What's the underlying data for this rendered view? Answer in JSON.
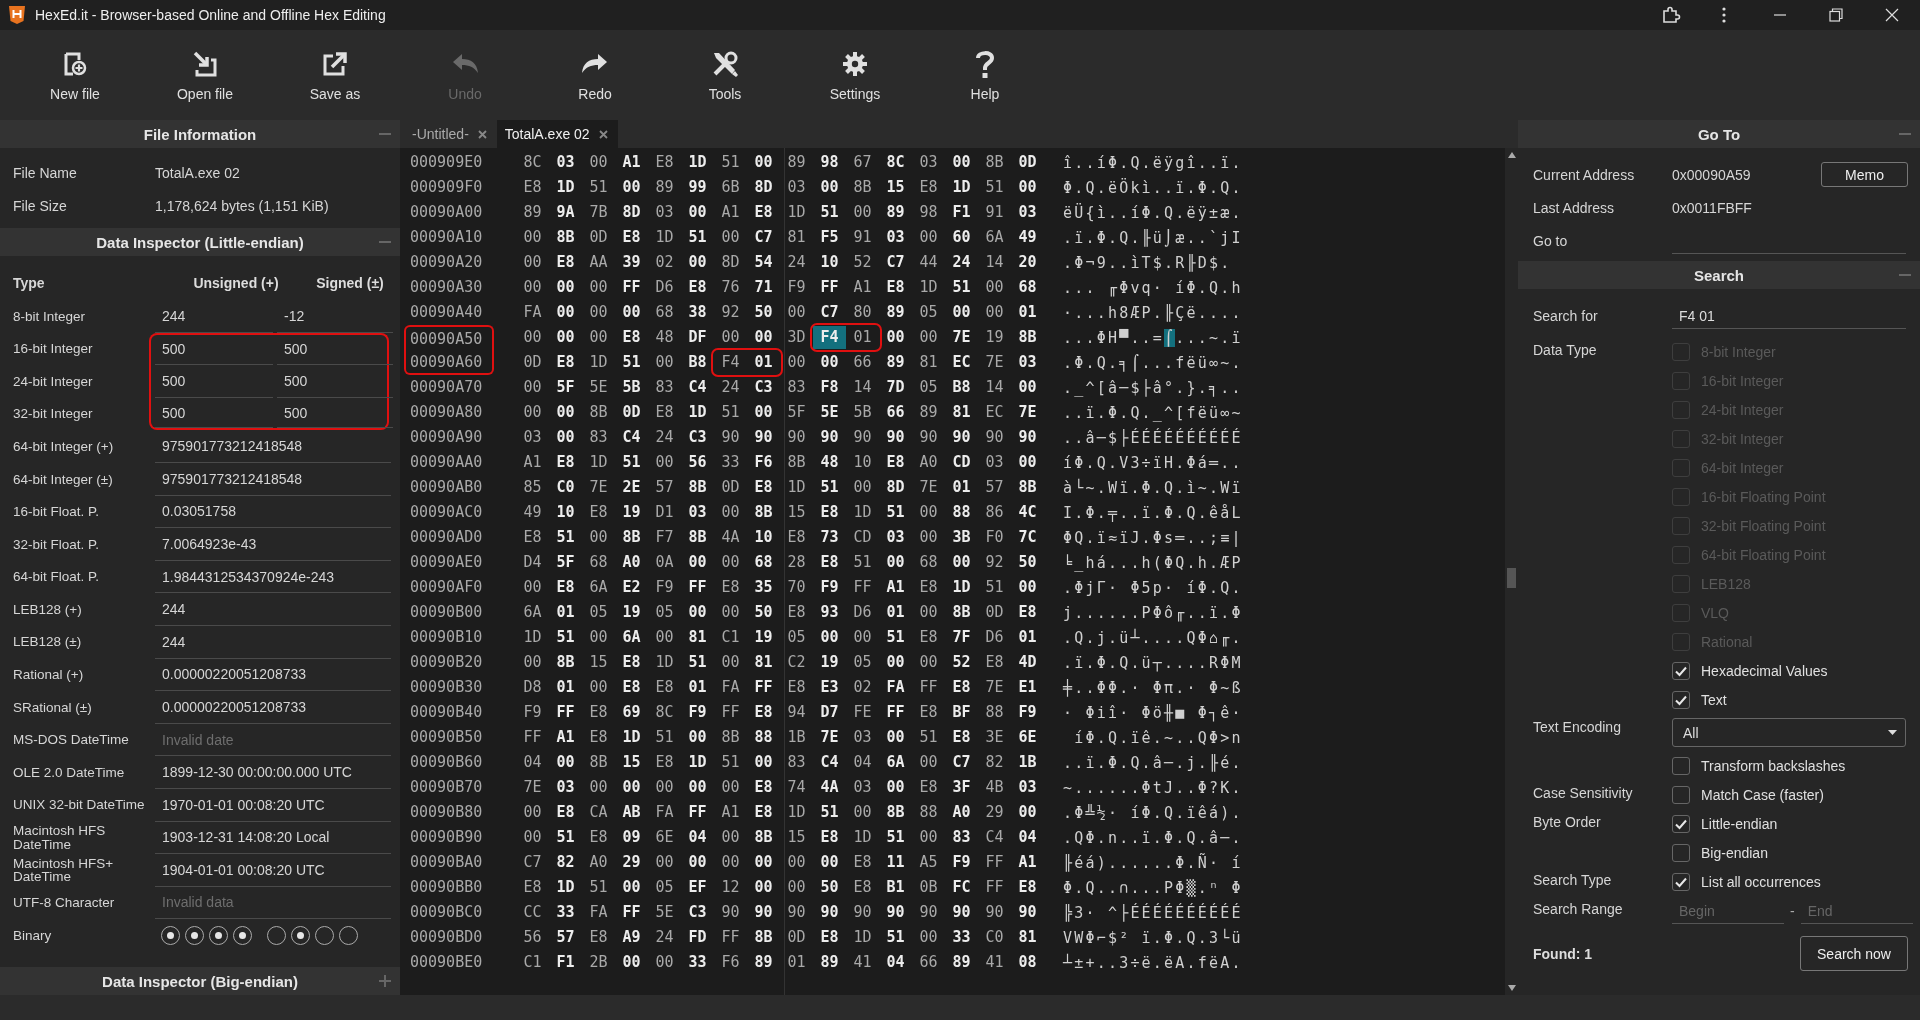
{
  "window": {
    "title": "HexEd.it - Browser-based Online and Offline Hex Editing"
  },
  "toolbar": [
    {
      "label": "New file",
      "disabled": false
    },
    {
      "label": "Open file",
      "disabled": false
    },
    {
      "label": "Save as",
      "disabled": false
    },
    {
      "label": "Undo",
      "disabled": true
    },
    {
      "label": "Redo",
      "disabled": false
    },
    {
      "label": "Tools",
      "disabled": false
    },
    {
      "label": "Settings",
      "disabled": false
    },
    {
      "label": "Help",
      "disabled": false
    }
  ],
  "left_panel": {
    "file_info": {
      "title": "File Information",
      "expanded": true,
      "rows": [
        {
          "label": "File Name",
          "value": "TotalA.exe 02"
        },
        {
          "label": "File Size",
          "value": "1,178,624 bytes (1,151 KiB)"
        }
      ]
    },
    "inspector": {
      "title": "Data Inspector (Little-endian)",
      "expanded": true,
      "columns": [
        "Type",
        "Unsigned (+)",
        "Signed (±)"
      ],
      "rows": [
        {
          "type": "8-bit Integer",
          "kind": "pair",
          "unsigned": "244",
          "signed": "-12",
          "boxed": false
        },
        {
          "type": "16-bit Integer",
          "kind": "pair",
          "unsigned": "500",
          "signed": "500",
          "boxed": true
        },
        {
          "type": "24-bit Integer",
          "kind": "pair",
          "unsigned": "500",
          "signed": "500",
          "boxed": true
        },
        {
          "type": "32-bit Integer",
          "kind": "pair",
          "unsigned": "500",
          "signed": "500",
          "boxed": true
        },
        {
          "type": "64-bit Integer (+)",
          "kind": "single",
          "value": "975901773212418548",
          "invalid": false
        },
        {
          "type": "64-bit Integer (±)",
          "kind": "single",
          "value": "975901773212418548",
          "invalid": false
        },
        {
          "type": "16-bit Float. P.",
          "kind": "single",
          "value": "0.03051758",
          "invalid": false
        },
        {
          "type": "32-bit Float. P.",
          "kind": "single",
          "value": "7.0064923e-43",
          "invalid": false
        },
        {
          "type": "64-bit Float. P.",
          "kind": "single",
          "value": "1.9844312534370924e-243",
          "invalid": false
        },
        {
          "type": "LEB128 (+)",
          "kind": "single",
          "value": "244",
          "invalid": false
        },
        {
          "type": "LEB128 (±)",
          "kind": "single",
          "value": "244",
          "invalid": false
        },
        {
          "type": "Rational (+)",
          "kind": "single",
          "value": "0.00000220051208733",
          "invalid": false
        },
        {
          "type": "SRational (±)",
          "kind": "single",
          "value": "0.00000220051208733",
          "invalid": false
        },
        {
          "type": "MS-DOS DateTime",
          "kind": "single",
          "value": "Invalid date",
          "invalid": true
        },
        {
          "type": "OLE 2.0 DateTime",
          "kind": "single",
          "value": "1899-12-30 00:00:00.000 UTC",
          "invalid": false
        },
        {
          "type": "UNIX 32-bit DateTime",
          "kind": "single",
          "value": "1970-01-01 00:08:20 UTC",
          "invalid": false
        },
        {
          "type": "Macintosh HFS DateTime",
          "kind": "single",
          "value": "1903-12-31 14:08:20 Local",
          "invalid": false
        },
        {
          "type": "Macintosh HFS+ DateTime",
          "kind": "single",
          "value": "1904-01-01 00:08:20 UTC",
          "invalid": false
        },
        {
          "type": "UTF-8 Character",
          "kind": "single",
          "value": "Invalid data",
          "invalid": true
        },
        {
          "type": "Binary",
          "kind": "bits",
          "bits": [
            {
              "on": true
            },
            {
              "on": true
            },
            {
              "on": true
            },
            {
              "on": true
            },
            {
              "on": false
            },
            {
              "on": true
            },
            {
              "on": false
            },
            {
              "on": false
            }
          ]
        }
      ]
    },
    "inspector_big": {
      "title": "Data Inspector (Big-endian)",
      "expanded": false
    }
  },
  "tabs": [
    {
      "label": "-Untitled-",
      "selected": false
    },
    {
      "label": "TotalA.exe 02",
      "selected": true
    }
  ],
  "hex_rows": [
    {
      "address": "000909E0",
      "boxed": false,
      "hex": [
        {
          "bytes": "8C 03 00 A1 E8 1D 51 00 89 98 67 8C 03 00 8B 0D",
          "boxed": false,
          "selected": false
        }
      ],
      "text": [
        {
          "chars": "î..íΦ.Q.ëÿgî..ï.",
          "selected": false
        }
      ]
    },
    {
      "address": "000909F0",
      "boxed": false,
      "hex": [
        {
          "bytes": "E8 1D 51 00 89 99 6B 8D 03 00 8B 15 E8 1D 51 00",
          "boxed": false,
          "selected": false
        }
      ],
      "text": [
        {
          "chars": "Φ.Q.ëÖkì..ï.Φ.Q.",
          "selected": false
        }
      ]
    },
    {
      "address": "00090A00",
      "boxed": false,
      "hex": [
        {
          "bytes": "89 9A 7B 8D 03 00 A1 E8 1D 51 00 89 98 F1 91 03",
          "boxed": false,
          "selected": false
        }
      ],
      "text": [
        {
          "chars": "ëÜ{ì..íΦ.Q.ëÿ±æ.",
          "selected": false
        }
      ]
    },
    {
      "address": "00090A10",
      "boxed": false,
      "hex": [
        {
          "bytes": "00 8B 0D E8 1D 51 00 C7 81 F5 91 03 00 60 6A 49",
          "boxed": false,
          "selected": false
        }
      ],
      "text": [
        {
          "chars": ".ï.Φ.Q.╟ü⌡æ..`jI",
          "selected": false
        }
      ]
    },
    {
      "address": "00090A20",
      "boxed": false,
      "hex": [
        {
          "bytes": "00 E8 AA 39 02 00 8D 54 24 10 52 C7 44 24 14 20",
          "boxed": false,
          "selected": false
        }
      ],
      "text": [
        {
          "chars": ".Φ¬9..ìT$.R╟D$.",
          "selected": false
        }
      ]
    },
    {
      "address": "00090A30",
      "boxed": false,
      "hex": [
        {
          "bytes": "00 00 00 FF D6 E8 76 71 F9 FF A1 E8 1D 51 00 68",
          "boxed": false,
          "selected": false
        }
      ],
      "text": [
        {
          "chars": "... ╓Φvq· íΦ.Q.h",
          "selected": false
        }
      ]
    },
    {
      "address": "00090A40",
      "boxed": false,
      "hex": [
        {
          "bytes": "FA 00 00 00 68 38 92 50 00 C7 80 89 05 00 00 01",
          "boxed": false,
          "selected": false
        }
      ],
      "text": [
        {
          "chars": "·...h8ÆP.╟Çë....",
          "selected": false
        }
      ]
    },
    {
      "address": "00090A50",
      "boxed": true,
      "hex": [
        {
          "bytes": "00 00 00 E8 48 DF 00 00 3D",
          "boxed": false,
          "selected": false
        },
        {
          "bytes": "F4",
          "boxed": true,
          "selected": true
        },
        {
          "bytes": "01",
          "boxed": true,
          "selected": false
        },
        {
          "bytes": "00 00 7E 19 8B",
          "boxed": false,
          "selected": false
        }
      ],
      "text": [
        {
          "chars": "...ΦH▀..=",
          "selected": false
        },
        {
          "chars": "⌠",
          "selected": true
        },
        {
          "chars": "...~.ï",
          "selected": false
        }
      ]
    },
    {
      "address": "00090A60",
      "boxed": true,
      "hex": [
        {
          "bytes": "0D E8 1D 51 00 B8",
          "boxed": false,
          "selected": false
        },
        {
          "bytes": "F4 01",
          "boxed": true,
          "selected": false
        },
        {
          "bytes": "00 00 66 89 81 EC 7E 03",
          "boxed": false,
          "selected": false
        }
      ],
      "text": [
        {
          "chars": ".Φ.Q.╕⌠...fëü∞~.",
          "selected": false
        }
      ]
    },
    {
      "address": "00090A70",
      "boxed": false,
      "hex": [
        {
          "bytes": "00 5F 5E 5B 83 C4 24 C3 83 F8 14 7D 05 B8 14 00",
          "boxed": false,
          "selected": false
        }
      ],
      "text": [
        {
          "chars": "._^[â─$├â°.}.╕..",
          "selected": false
        }
      ]
    },
    {
      "address": "00090A80",
      "boxed": false,
      "hex": [
        {
          "bytes": "00 00 8B 0D E8 1D 51 00 5F 5E 5B 66 89 81 EC 7E",
          "boxed": false,
          "selected": false
        }
      ],
      "text": [
        {
          "chars": "..ï.Φ.Q._^[fëü∞~",
          "selected": false
        }
      ]
    },
    {
      "address": "00090A90",
      "boxed": false,
      "hex": [
        {
          "bytes": "03 00 83 C4 24 C3 90 90 90 90 90 90 90 90 90 90",
          "boxed": false,
          "selected": false
        }
      ],
      "text": [
        {
          "chars": "..â─$├ÉÉÉÉÉÉÉÉÉÉ",
          "selected": false
        }
      ]
    },
    {
      "address": "00090AA0",
      "boxed": false,
      "hex": [
        {
          "bytes": "A1 E8 1D 51 00 56 33 F6 8B 48 10 E8 A0 CD 03 00",
          "boxed": false,
          "selected": false
        }
      ],
      "text": [
        {
          "chars": "íΦ.Q.V3÷ïH.Φá═..",
          "selected": false
        }
      ]
    },
    {
      "address": "00090AB0",
      "boxed": false,
      "hex": [
        {
          "bytes": "85 C0 7E 2E 57 8B 0D E8 1D 51 00 8D 7E 01 57 8B",
          "boxed": false,
          "selected": false
        }
      ],
      "text": [
        {
          "chars": "à└~.Wï.Φ.Q.ì~.Wï",
          "selected": false
        }
      ]
    },
    {
      "address": "00090AC0",
      "boxed": false,
      "hex": [
        {
          "bytes": "49 10 E8 19 D1 03 00 8B 15 E8 1D 51 00 88 86 4C",
          "boxed": false,
          "selected": false
        }
      ],
      "text": [
        {
          "chars": "I.Φ.╤..ï.Φ.Q.êåL",
          "selected": false
        }
      ]
    },
    {
      "address": "00090AD0",
      "boxed": false,
      "hex": [
        {
          "bytes": "E8 51 00 8B F7 8B 4A 10 E8 73 CD 03 00 3B F0 7C",
          "boxed": false,
          "selected": false
        }
      ],
      "text": [
        {
          "chars": "ΦQ.ï≈ïJ.Φs═..;≡|",
          "selected": false
        }
      ]
    },
    {
      "address": "00090AE0",
      "boxed": false,
      "hex": [
        {
          "bytes": "D4 5F 68 A0 0A 00 00 68 28 E8 51 00 68 00 92 50",
          "boxed": false,
          "selected": false
        }
      ],
      "text": [
        {
          "chars": "╘_há...h(ΦQ.h.ÆP",
          "selected": false
        }
      ]
    },
    {
      "address": "00090AF0",
      "boxed": false,
      "hex": [
        {
          "bytes": "00 E8 6A E2 F9 FF E8 35 70 F9 FF A1 E8 1D 51 00",
          "boxed": false,
          "selected": false
        }
      ],
      "text": [
        {
          "chars": ".ΦjΓ· Φ5p· íΦ.Q.",
          "selected": false
        }
      ]
    },
    {
      "address": "00090B00",
      "boxed": false,
      "hex": [
        {
          "bytes": "6A 01 05 19 05 00 00 50 E8 93 D6 01 00 8B 0D E8",
          "boxed": false,
          "selected": false
        }
      ],
      "text": [
        {
          "chars": "j......PΦô╓..ï.Φ",
          "selected": false
        }
      ]
    },
    {
      "address": "00090B10",
      "boxed": false,
      "hex": [
        {
          "bytes": "1D 51 00 6A 00 81 C1 19 05 00 00 51 E8 7F D6 01",
          "boxed": false,
          "selected": false
        }
      ],
      "text": [
        {
          "chars": ".Q.j.ü┴....QΦ⌂╓.",
          "selected": false
        }
      ]
    },
    {
      "address": "00090B20",
      "boxed": false,
      "hex": [
        {
          "bytes": "00 8B 15 E8 1D 51 00 81 C2 19 05 00 00 52 E8 4D",
          "boxed": false,
          "selected": false
        }
      ],
      "text": [
        {
          "chars": ".ï.Φ.Q.ü┬....RΦM",
          "selected": false
        }
      ]
    },
    {
      "address": "00090B30",
      "boxed": false,
      "hex": [
        {
          "bytes": "D8 01 00 E8 E8 01 FA FF E8 E3 02 FA FF E8 7E E1",
          "boxed": false,
          "selected": false
        }
      ],
      "text": [
        {
          "chars": "╪..ΦΦ.· Φπ.· Φ~ß",
          "selected": false
        }
      ]
    },
    {
      "address": "00090B40",
      "boxed": false,
      "hex": [
        {
          "bytes": "F9 FF E8 69 8C F9 FF E8 94 D7 FE FF E8 BF 88 F9",
          "boxed": false,
          "selected": false
        }
      ],
      "text": [
        {
          "chars": "· Φiî· Φö╫■ Φ┐ê·",
          "selected": false
        }
      ]
    },
    {
      "address": "00090B50",
      "boxed": false,
      "hex": [
        {
          "bytes": "FF A1 E8 1D 51 00 8B 88 1B 7E 03 00 51 E8 3E 6E",
          "boxed": false,
          "selected": false
        }
      ],
      "text": [
        {
          "chars": " íΦ.Q.ïê.~..QΦ>n",
          "selected": false
        }
      ]
    },
    {
      "address": "00090B60",
      "boxed": false,
      "hex": [
        {
          "bytes": "04 00 8B 15 E8 1D 51 00 83 C4 04 6A 00 C7 82 1B",
          "boxed": false,
          "selected": false
        }
      ],
      "text": [
        {
          "chars": "..ï.Φ.Q.â─.j.╟é.",
          "selected": false
        }
      ]
    },
    {
      "address": "00090B70",
      "boxed": false,
      "hex": [
        {
          "bytes": "7E 03 00 00 00 00 00 E8 74 4A 03 00 E8 3F 4B 03",
          "boxed": false,
          "selected": false
        }
      ],
      "text": [
        {
          "chars": "~......ΦtJ..Φ?K.",
          "selected": false
        }
      ]
    },
    {
      "address": "00090B80",
      "boxed": false,
      "hex": [
        {
          "bytes": "00 E8 CA AB FA FF A1 E8 1D 51 00 8B 88 A0 29 00",
          "boxed": false,
          "selected": false
        }
      ],
      "text": [
        {
          "chars": ".Φ╩½· íΦ.Q.ïêá).",
          "selected": false
        }
      ]
    },
    {
      "address": "00090B90",
      "boxed": false,
      "hex": [
        {
          "bytes": "00 51 E8 09 6E 04 00 8B 15 E8 1D 51 00 83 C4 04",
          "boxed": false,
          "selected": false
        }
      ],
      "text": [
        {
          "chars": ".QΦ.n..ï.Φ.Q.â─.",
          "selected": false
        }
      ]
    },
    {
      "address": "00090BA0",
      "boxed": false,
      "hex": [
        {
          "bytes": "C7 82 A0 29 00 00 00 00 00 00 E8 11 A5 F9 FF A1",
          "boxed": false,
          "selected": false
        }
      ],
      "text": [
        {
          "chars": "╟éá)......Φ.Ñ· í",
          "selected": false
        }
      ]
    },
    {
      "address": "00090BB0",
      "boxed": false,
      "hex": [
        {
          "bytes": "E8 1D 51 00 05 EF 12 00 00 50 E8 B1 0B FC FF E8",
          "boxed": false,
          "selected": false
        }
      ],
      "text": [
        {
          "chars": "Φ.Q..∩...PΦ▒.ⁿ Φ",
          "selected": false
        }
      ]
    },
    {
      "address": "00090BC0",
      "boxed": false,
      "hex": [
        {
          "bytes": "CC 33 FA FF 5E C3 90 90 90 90 90 90 90 90 90 90",
          "boxed": false,
          "selected": false
        }
      ],
      "text": [
        {
          "chars": "╠3· ^├ÉÉÉÉÉÉÉÉÉÉ",
          "selected": false
        }
      ]
    },
    {
      "address": "00090BD0",
      "boxed": false,
      "hex": [
        {
          "bytes": "56 57 E8 A9 24 FD FF 8B 0D E8 1D 51 00 33 C0 81",
          "boxed": false,
          "selected": false
        }
      ],
      "text": [
        {
          "chars": "VWΦ⌐$² ï.Φ.Q.3└ü",
          "selected": false
        }
      ]
    },
    {
      "address": "00090BE0",
      "boxed": false,
      "hex": [
        {
          "bytes": "C1 F1 2B 00 00 33 F6 89 01 89 41 04 66 89 41 08",
          "boxed": false,
          "selected": false
        }
      ],
      "text": [
        {
          "chars": "┴±+..3÷ë.ëA.fëA.",
          "selected": false
        }
      ]
    }
  ],
  "right_panel": {
    "goto": {
      "title": "Go To",
      "expanded": true,
      "current_label": "Current Address",
      "current_value": "0x00090A59",
      "memo_button": "Memo",
      "last_label": "Last Address",
      "last_value": "0x0011FBFF",
      "goto_label": "Go to"
    },
    "search": {
      "title": "Search",
      "expanded": true,
      "groups": [
        {
          "kind": "field",
          "label": "Search for",
          "value": "F4 01"
        },
        {
          "kind": "checkboxes",
          "label": "Data Type",
          "options": [
            {
              "label": "8-bit Integer",
              "checked": false,
              "disabled": true
            },
            {
              "label": "16-bit Integer",
              "checked": false,
              "disabled": true
            },
            {
              "label": "24-bit Integer",
              "checked": false,
              "disabled": true
            },
            {
              "label": "32-bit Integer",
              "checked": false,
              "disabled": true
            },
            {
              "label": "64-bit Integer",
              "checked": false,
              "disabled": true
            },
            {
              "label": "16-bit Floating Point",
              "checked": false,
              "disabled": true
            },
            {
              "label": "32-bit Floating Point",
              "checked": false,
              "disabled": true
            },
            {
              "label": "64-bit Floating Point",
              "checked": false,
              "disabled": true
            },
            {
              "label": "LEB128",
              "checked": false,
              "disabled": true
            },
            {
              "label": "VLQ",
              "checked": false,
              "disabled": true
            },
            {
              "label": "Rational",
              "checked": false,
              "disabled": true
            },
            {
              "label": "Hexadecimal Values",
              "checked": true,
              "disabled": false
            },
            {
              "label": "Text",
              "checked": true,
              "disabled": false
            }
          ]
        },
        {
          "kind": "select",
          "label": "Text Encoding",
          "value": "All"
        },
        {
          "kind": "checkboxes",
          "options": [
            {
              "label": "Transform backslashes",
              "checked": false,
              "disabled": false
            }
          ]
        },
        {
          "kind": "checkboxes",
          "label": "Case Sensitivity",
          "options": [
            {
              "label": "Match Case (faster)",
              "checked": false,
              "disabled": false
            }
          ]
        },
        {
          "kind": "checkboxes",
          "label": "Byte Order",
          "options": [
            {
              "label": "Little-endian",
              "checked": true,
              "disabled": false
            },
            {
              "label": "Big-endian",
              "checked": false,
              "disabled": false
            }
          ]
        },
        {
          "kind": "checkboxes",
          "label": "Search Type",
          "options": [
            {
              "label": "List all occurrences",
              "checked": true,
              "disabled": false
            }
          ]
        },
        {
          "kind": "range",
          "label": "Search Range",
          "begin_placeholder": "Begin",
          "separator": "-",
          "end_placeholder": "End"
        }
      ],
      "found": "Found: 1",
      "search_button": "Search now"
    }
  }
}
